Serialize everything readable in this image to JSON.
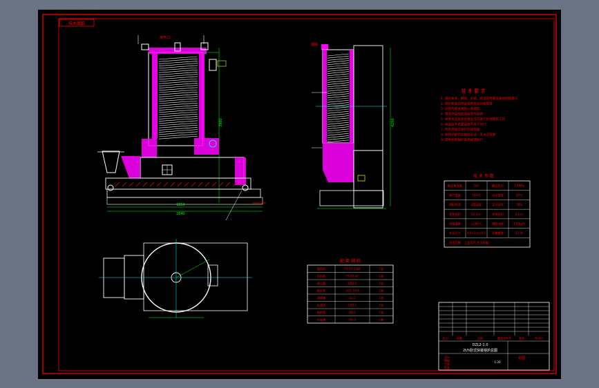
{
  "sheet": {
    "tag_label": "技术图纸",
    "border_color": "#ff0000",
    "line_color": "#ffffff",
    "hatch_color": "#ff00ff",
    "dim_color": "#00ff00",
    "center_color": "#00ffff",
    "accent_color": "#ffff00"
  },
  "front_view": {
    "top_label": "排气口",
    "dim_label_height": "3980",
    "dim_label_width": "2840",
    "dim_label_base": "1850"
  },
  "side_view": {
    "top_label": "烟囱",
    "dim_label_height": "4200"
  },
  "tech_requirements": {
    "title": "技 术 要 求",
    "items": [
      "1. 锅炉本体、钢架、炉墙、保温及附属设备按图纸施工",
      "2. 锅炉安装应符合相关安装验收规范",
      "3. 炉膛内壁采用耐火砖砌筑",
      "4. 管道焊接前应清除管内杂物",
      "5. 本体水压试验合格后方可进行炉墙砌筑工作",
      "6. 保温层外表面温度不高于50℃",
      "7. 所有焊缝应进行外观检查",
      "8. 各转动部件应转动灵活，无卡涩现象",
      "9. 其余按照锅炉安装规范执行"
    ]
  },
  "spec_table": {
    "title": "技 术 参 数",
    "rows": [
      [
        "额定蒸发量",
        "2t/h",
        "额定压力",
        "1.0MPa"
      ],
      [
        "蒸汽温度",
        "184℃",
        "给水温度",
        "20℃"
      ],
      [
        "燃料种类",
        "Ⅱ类烟煤",
        "设计效率",
        "78%"
      ],
      [
        "受热面积",
        "61.2m²",
        "炉排面积",
        "3.1m²"
      ],
      [
        "排烟温度",
        "≤160℃",
        "燃料消耗",
        "320kg/h"
      ],
      [
        "外形尺寸",
        "4.6×2.4×4.1",
        "运输重量",
        "12.5t"
      ],
      [
        "适用范围",
        "工业用汽  生活采暖",
        "",
        ""
      ]
    ]
  },
  "parts_table": {
    "title": "配 套 辅 机",
    "rows": [
      [
        "鼓风机",
        "T4-72-2.8A",
        "1台"
      ],
      [
        "引风机",
        "Y5-47-4C",
        "1台"
      ],
      [
        "除尘器",
        "XZD-2",
        "1台"
      ],
      [
        "给水泵",
        "2GC-5×4",
        "2台"
      ],
      [
        "调速箱",
        "GL-2",
        "1台"
      ],
      [
        "出渣机",
        "LSX-2",
        "1台"
      ],
      [
        "电控柜",
        "DK-2",
        "1台"
      ],
      [
        "水处理",
        "SG-2",
        "1套"
      ]
    ]
  },
  "title_block": {
    "drawing_no": "DZL2-1.0",
    "drawing_name": "2t/h卧式快装锅炉总图",
    "scale": "1:20",
    "sheet_label": "总图",
    "headers": [
      "标记",
      "处数",
      "分区",
      "更改文件号",
      "签名",
      "年月日"
    ],
    "signs": [
      "设计",
      "审核",
      "工艺",
      "批准"
    ]
  }
}
